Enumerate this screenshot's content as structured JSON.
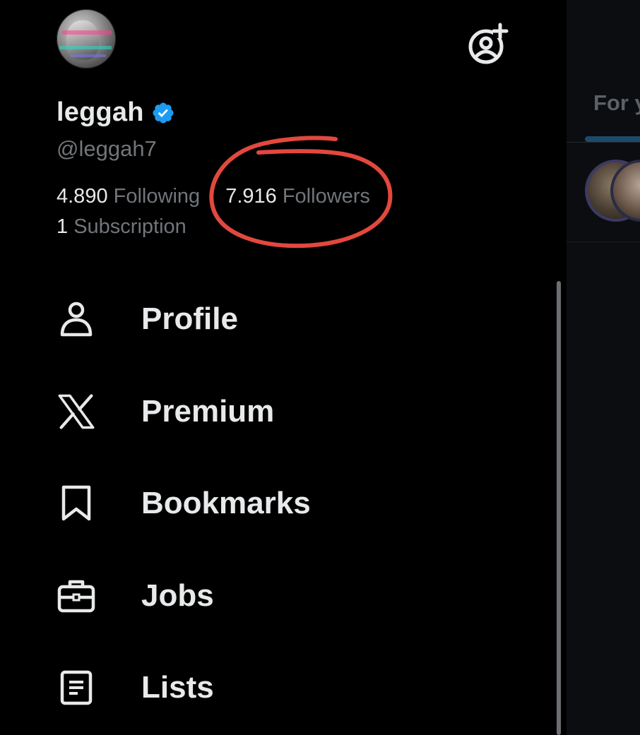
{
  "profile": {
    "display_name": "leggah",
    "handle": "@leggah7",
    "verified": true,
    "avatar_icon": "glitch-statue-avatar",
    "following_count": "4.890",
    "following_label": "Following",
    "followers_count": "7.916",
    "followers_label": "Followers",
    "subscriptions_count": "1",
    "subscriptions_label": "Subscription"
  },
  "header": {
    "add_account_icon": "person-plus-icon"
  },
  "menu": {
    "items": [
      {
        "label": "Profile",
        "icon": "person-icon"
      },
      {
        "label": "Premium",
        "icon": "x-logo-icon"
      },
      {
        "label": "Bookmarks",
        "icon": "bookmark-icon"
      },
      {
        "label": "Jobs",
        "icon": "briefcase-icon"
      },
      {
        "label": "Lists",
        "icon": "list-icon"
      }
    ]
  },
  "feed": {
    "active_tab": "For y"
  },
  "colors": {
    "background": "#000000",
    "text_primary": "#e7e9ea",
    "text_secondary": "#71767b",
    "verified_blue": "#1d9bf0",
    "annotation_red": "#e2483d"
  }
}
